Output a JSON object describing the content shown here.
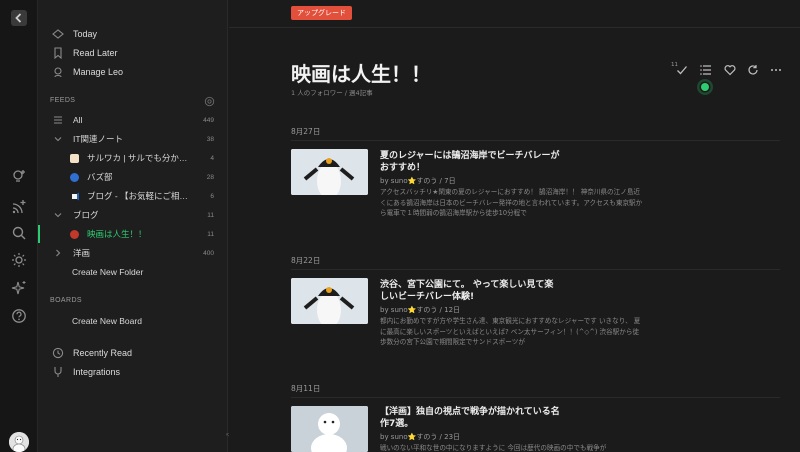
{
  "rail": {
    "icons": [
      "logo-icon",
      "add-idea-icon",
      "add-feed-icon",
      "search-icon",
      "theme-icon",
      "sparkle-icon",
      "help-icon"
    ]
  },
  "sidebar": {
    "nav": [
      {
        "label": "Today",
        "icon": "today-icon"
      },
      {
        "label": "Read Later",
        "icon": "bookmark-icon"
      },
      {
        "label": "Manage Leo",
        "icon": "leo-icon"
      }
    ],
    "feeds_heading": "FEEDS",
    "feeds": [
      {
        "label": "All",
        "count": "449"
      },
      {
        "label": "IT関連ノート",
        "count": "38"
      },
      {
        "label": "サルワカ | サルでも分か…",
        "count": "4"
      },
      {
        "label": "バズ部",
        "count": "28"
      },
      {
        "label": "ブログ - 【お気軽にご相…",
        "count": "6"
      },
      {
        "label": "ブログ",
        "count": "11"
      },
      {
        "label": "映画は人生！！",
        "count": "11"
      },
      {
        "label": "洋画",
        "count": "400"
      }
    ],
    "create_folder": "Create New Folder",
    "boards_heading": "BOARDS",
    "create_board": "Create New Board",
    "bottom": [
      {
        "label": "Recently Read",
        "icon": "clock-icon"
      },
      {
        "label": "Integrations",
        "icon": "integrations-icon"
      }
    ]
  },
  "main": {
    "upgrade_label": "アップグレード",
    "title": "映画は人生！！",
    "meta": "1 人のフォロワー / 週4記事",
    "tool_badge": "11",
    "sections": [
      {
        "date": "8月27日",
        "article": {
          "title": "夏のレジャーには鵠沼海岸でビーチバレーがおすすめ！",
          "byline": "by suno⭐すのう / 7日",
          "snippet": "アクセスバッチリ★閑東の夏のレジャーにおすすめ！ 鵠沼海岸！！ 神奈川県の江ノ島近くにある鵠沼海岸は日本のビーチバレー発祥の地と言われています。アクセスも東京駅から電車で１時間弱の鵠沼海岸駅から徒歩10分程で"
        }
      },
      {
        "date": "8月22日",
        "article": {
          "title": "渋谷、宮下公園にて。 やって楽しい見て楽しいビーチバレー体験!",
          "byline": "by suno⭐すのう / 12日",
          "snippet": "都内にお勤めですが方や学生さん達、東京観光におすすめなレジャーです いきなり、 夏に最高に楽しいスポーツといえばといえば? ベン太サーフィン！！(^◇^) 渋谷駅から徒歩数分の宮下公園で期間限定でサンドスポーツが"
        }
      },
      {
        "date": "8月11日",
        "article": {
          "title": "【洋画】独自の視点で戦争が描かれている名作7選。",
          "byline": "by suno⭐すのう / 23日",
          "snippet": "戦いのない平和な世の中になりますように 今回は歴代の映画の中でも戦争が"
        }
      }
    ]
  }
}
